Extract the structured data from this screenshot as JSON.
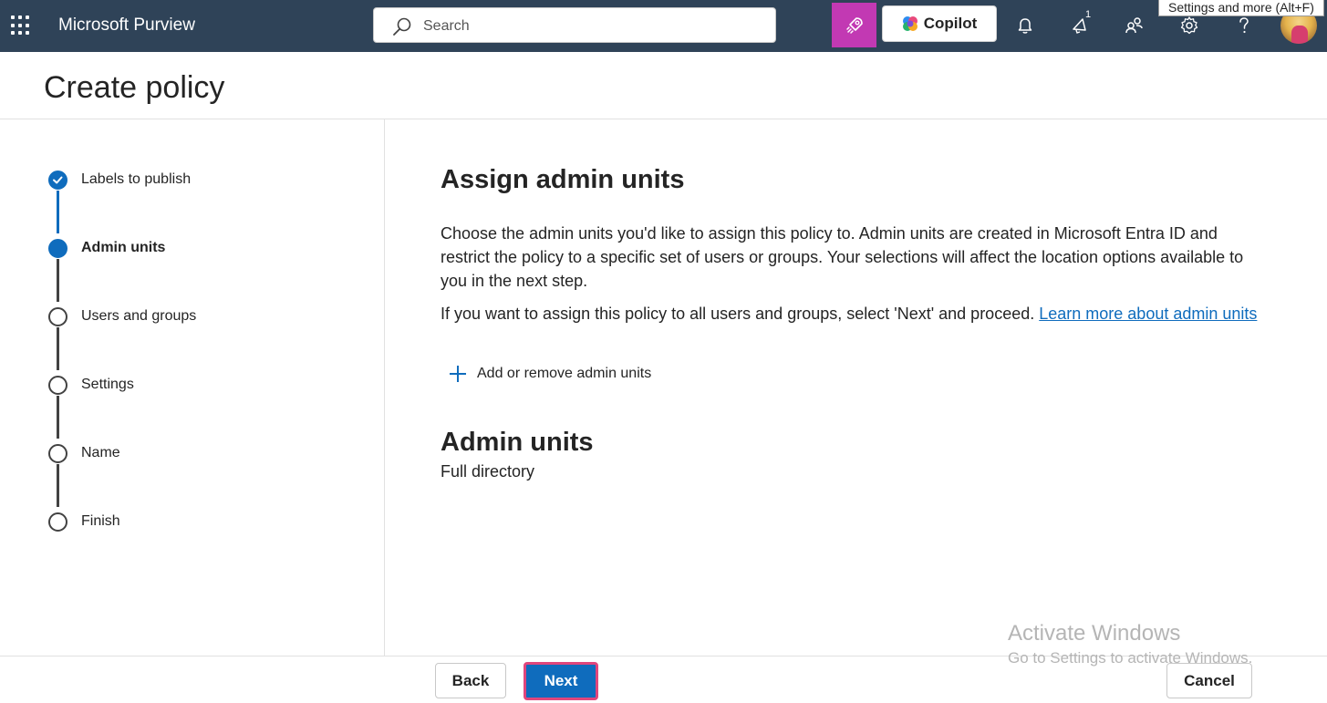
{
  "topbar": {
    "app_title": "Microsoft Purview",
    "search_placeholder": "Search",
    "copilot_label": "Copilot",
    "notification_count": "1",
    "tooltip": "Settings and more (Alt+F)"
  },
  "header": {
    "title": "Create policy"
  },
  "stepper": {
    "steps": [
      {
        "label": "Labels to publish",
        "state": "completed"
      },
      {
        "label": "Admin units",
        "state": "current"
      },
      {
        "label": "Users and groups",
        "state": "pending"
      },
      {
        "label": "Settings",
        "state": "pending"
      },
      {
        "label": "Name",
        "state": "pending"
      },
      {
        "label": "Finish",
        "state": "pending"
      }
    ]
  },
  "main": {
    "heading": "Assign admin units",
    "description": "Choose the admin units you'd like to assign this policy to. Admin units are created in Microsoft Entra ID and restrict the policy to a specific set of users or groups. Your selections will affect the location options available to you in the next step.",
    "description2": "If you want to assign this policy to all users and groups, select 'Next' and proceed.",
    "learn_more_link": "Learn more about admin units",
    "add_remove_label": "Add or remove admin units",
    "admin_units_heading": "Admin units",
    "admin_units_value": "Full directory"
  },
  "footer": {
    "back_label": "Back",
    "next_label": "Next",
    "cancel_label": "Cancel"
  },
  "watermark": {
    "line1": "Activate Windows",
    "line2": "Go to Settings to activate Windows."
  },
  "colors": {
    "topbar_bg": "#2f4358",
    "accent": "#0f6cbd",
    "rocket_bg": "#c239b3",
    "next_outline": "#e0467c"
  },
  "icons": [
    "app-launcher-icon",
    "search-icon",
    "rocket-icon",
    "copilot-icon",
    "bell-icon",
    "megaphone-icon",
    "people-icon",
    "gear-icon",
    "help-icon",
    "plus-icon",
    "checkmark-icon"
  ]
}
